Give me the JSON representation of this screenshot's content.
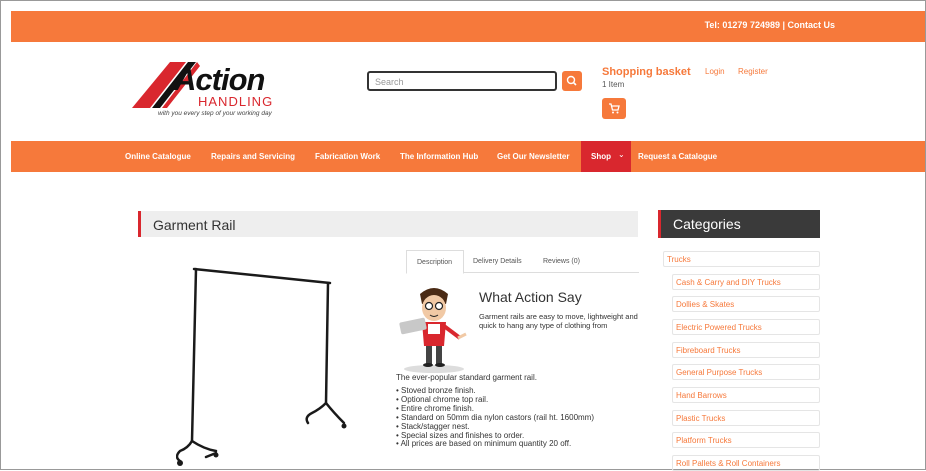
{
  "topbar": {
    "contact": "Tel: 01279 724989 | Contact Us"
  },
  "logo": {
    "word1": "Action",
    "word2": "HANDLING",
    "tagline": "with you every step of your working day"
  },
  "search": {
    "placeholder": "Search"
  },
  "basket": {
    "title": "Shopping basket",
    "items": "1 Item",
    "login": "Login",
    "register": "Register"
  },
  "nav": {
    "items": [
      "Online Catalogue",
      "Repairs and Servicing",
      "Fabrication Work",
      "The Information Hub",
      "Get Our Newsletter",
      "Shop",
      "Request a Catalogue"
    ],
    "shop_chevron": "⌄"
  },
  "product": {
    "title": "Garment Rail",
    "tabs": [
      "Description",
      "Delivery Details",
      "Reviews (0)"
    ],
    "what_heading": "What Action Say",
    "what_text": "Garment rails are easy to move, lightweight and quick to hang any type of clothing from",
    "intro": "The ever-popular standard garment rail.",
    "bullets": [
      "Stoved bronze finish.",
      "Optional chrome top rail.",
      "Entire chrome finish.",
      "Standard on 50mm dia nylon castors (rail ht. 1600mm)",
      "Stack/stagger nest.",
      "Special sizes and finishes to order.",
      "All prices are based on minimum quantity 20 off."
    ]
  },
  "categories": {
    "heading": "Categories",
    "parent": "Trucks",
    "items": [
      "Cash & Carry and DIY Trucks",
      "Dollies & Skates",
      "Electric Powered Trucks",
      "Fibreboard Trucks",
      "General Purpose Trucks",
      "Hand Barrows",
      "Plastic Trucks",
      "Platform Trucks",
      "Roll Pallets & Roll Containers"
    ]
  },
  "colors": {
    "brand_orange": "#f6793b",
    "brand_red": "#d9272e",
    "dark": "#3a3a3a"
  },
  "icons": {
    "search": "search-icon",
    "cart": "cart-icon",
    "shop_chevron": "chevron-down-icon"
  }
}
